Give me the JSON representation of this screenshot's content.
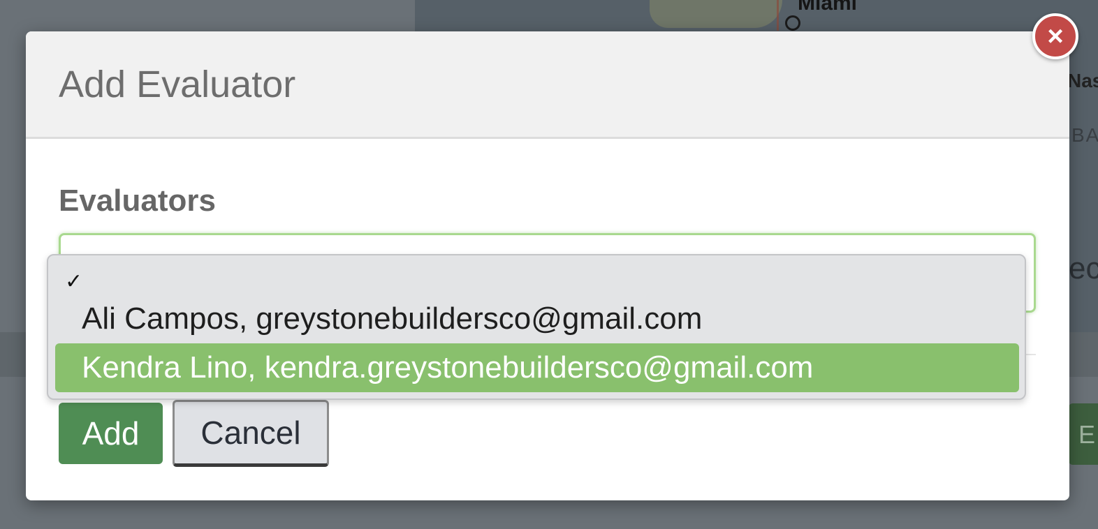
{
  "background": {
    "map_city": "Miami",
    "map_text_right": "Nas",
    "map_text_right2": "BA",
    "side_text": "ec",
    "side_button": "E",
    "bottom_text": "."
  },
  "modal": {
    "title": "Add Evaluator",
    "close_icon": "×",
    "field_label": "Evaluators",
    "add_label": "Add",
    "cancel_label": "Cancel"
  },
  "dropdown": {
    "check_glyph": "✓",
    "options": [
      {
        "label": "",
        "checked": true
      },
      {
        "label": "Ali Campos, greystonebuildersco@gmail.com"
      },
      {
        "label": "Kendra Lino, kendra.greystonebuildersco@gmail.com",
        "highlighted": true
      }
    ]
  },
  "colors": {
    "highlight": "#89c06d",
    "add_button": "#4f8d54",
    "close_button": "#c24a47",
    "focus_border": "#a9d98f"
  }
}
